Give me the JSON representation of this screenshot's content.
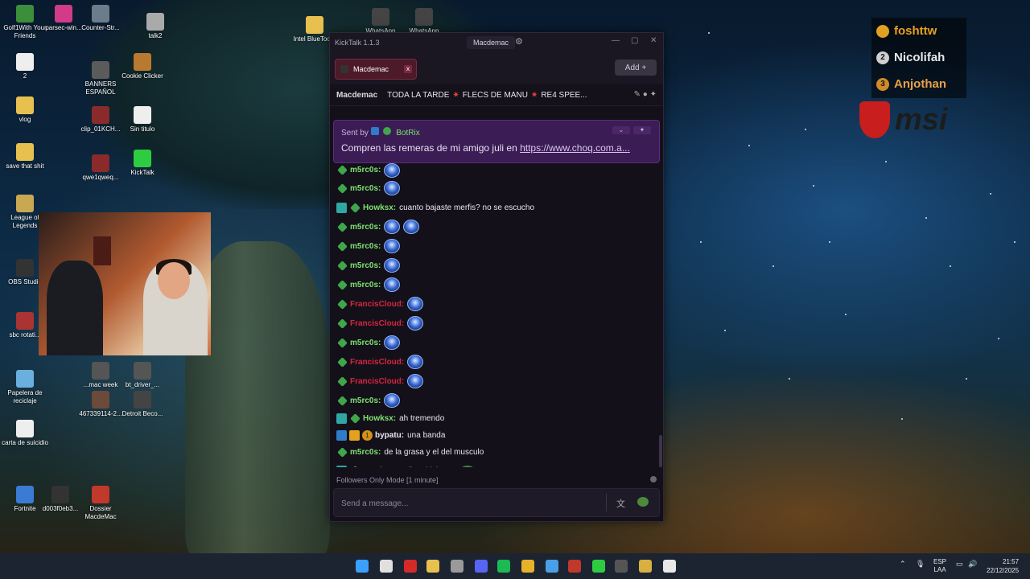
{
  "desktop": {
    "icons": [
      {
        "label": "Golf1With Your Friends",
        "color": "#3b8e3a"
      },
      {
        "label": "parsec-win...",
        "color": "#d13b8a"
      },
      {
        "label": "Counter-Str...",
        "color": "#6b7d8a"
      },
      {
        "label": "talk2",
        "color": "#aaaaaa"
      },
      {
        "label": "2",
        "color": "#eeeeee"
      },
      {
        "label": "BANNERS ESPAÑOL",
        "color": "#5b5b5b"
      },
      {
        "label": "Cookie Clicker",
        "color": "#b97a2f"
      },
      {
        "label": "vlog",
        "color": "#e8c050"
      },
      {
        "label": "clip_01KCH...",
        "color": "#8a2a2a"
      },
      {
        "label": "Sin titulo",
        "color": "#eeeeee"
      },
      {
        "label": "save that shit",
        "color": "#e8c050"
      },
      {
        "label": "qwe1qweq...",
        "color": "#8a2a2a"
      },
      {
        "label": "KickTalk",
        "color": "#2ecc40"
      },
      {
        "label": "League of Legends",
        "color": "#c8a850"
      },
      {
        "label": "OBS Studio",
        "color": "#333333"
      },
      {
        "label": "sbc rotati...",
        "color": "#a33"
      },
      {
        "label": "...mac week",
        "color": "#555"
      },
      {
        "label": "bt_driver_...",
        "color": "#555"
      },
      {
        "label": "Papelera de reciclaje",
        "color": "#6ab0de"
      },
      {
        "label": "467339114-2...",
        "color": "#6b4a3a"
      },
      {
        "label": "Detroit Beco...",
        "color": "#444"
      },
      {
        "label": "carta de suicidio",
        "color": "#eeeeee"
      },
      {
        "label": "Fortnite",
        "color": "#3a7bd5"
      },
      {
        "label": "d003f0eb3...",
        "color": "#333"
      },
      {
        "label": "Dossier MacdeMac",
        "color": "#c0392b"
      },
      {
        "label": "Intel BlueTooth",
        "color": "#e8c050"
      },
      {
        "label": "WhatsApp",
        "color": "#444"
      },
      {
        "label": "WhatsApp",
        "color": "#444"
      }
    ]
  },
  "leaderboard": [
    {
      "rank": "",
      "name": "foshttw",
      "badge_color": "#e0a020",
      "text_color": "#e8a01c"
    },
    {
      "rank": "2",
      "name": "Nicolifah",
      "badge_color": "#cfcfcf",
      "text_color": "#e8e8e8"
    },
    {
      "rank": "3",
      "name": "Anjothan",
      "badge_color": "#d08a2a",
      "text_color": "#e8a048"
    }
  ],
  "brand": {
    "logo_text": "msi"
  },
  "window": {
    "app_name": "KickTalk 1.1.3",
    "active_channel_chip": "Macdemac",
    "tab": {
      "label": "Macdemac",
      "close": "x"
    },
    "add_label": "Add +",
    "channel": {
      "name": "Macdemac",
      "title_parts": [
        "TODA LA TARDE",
        "FLECS DE MANU",
        "RE4 SPEE..."
      ]
    },
    "pinned": {
      "sent_by_label": "Sent by",
      "author": "BotRix",
      "text": "Compren las remeras de mi amigo juli en ",
      "link": "https://www.choq.com.a..."
    },
    "messages": [
      {
        "user": "m5rc0s:",
        "text": "",
        "color": "#7ee36f",
        "badges": [
          "sub"
        ],
        "emotes": 1,
        "compact": true
      },
      {
        "user": "m5rc0s:",
        "text": "",
        "color": "#7ee36f",
        "badges": [
          "sub"
        ],
        "emotes": 1
      },
      {
        "user": "Howksx:",
        "text": "cuanto bajaste merfis? no se escucho",
        "color": "#7ee36f",
        "badges": [
          "mod",
          "sub"
        ],
        "emotes": 0
      },
      {
        "user": "m5rc0s:",
        "text": "",
        "color": "#7ee36f",
        "badges": [
          "sub"
        ],
        "emotes": 2
      },
      {
        "user": "m5rc0s:",
        "text": "",
        "color": "#7ee36f",
        "badges": [
          "sub"
        ],
        "emotes": 1
      },
      {
        "user": "m5rc0s:",
        "text": "",
        "color": "#7ee36f",
        "badges": [
          "sub"
        ],
        "emotes": 1
      },
      {
        "user": "m5rc0s:",
        "text": "",
        "color": "#7ee36f",
        "badges": [
          "sub"
        ],
        "emotes": 1
      },
      {
        "user": "FrancisCloud:",
        "text": "",
        "color": "#d6263d",
        "badges": [
          "sub"
        ],
        "emotes": 1
      },
      {
        "user": "FrancisCloud:",
        "text": "",
        "color": "#d6263d",
        "badges": [
          "sub"
        ],
        "emotes": 1
      },
      {
        "user": "m5rc0s:",
        "text": "",
        "color": "#7ee36f",
        "badges": [
          "sub"
        ],
        "emotes": 1
      },
      {
        "user": "FrancisCloud:",
        "text": "",
        "color": "#d6263d",
        "badges": [
          "sub"
        ],
        "emotes": 1
      },
      {
        "user": "FrancisCloud:",
        "text": "",
        "color": "#d6263d",
        "badges": [
          "sub"
        ],
        "emotes": 1
      },
      {
        "user": "m5rc0s:",
        "text": "",
        "color": "#7ee36f",
        "badges": [
          "sub"
        ],
        "emotes": 1
      },
      {
        "user": "Howksx:",
        "text": "ah tremendo",
        "color": "#7ee36f",
        "badges": [
          "mod",
          "sub"
        ],
        "emotes": 0,
        "compact": true
      },
      {
        "user": "bypatu:",
        "text": "una banda",
        "color": "#e9e6ee",
        "badges": [
          "blue",
          "crown",
          "one"
        ],
        "emotes": 0,
        "compact": true
      },
      {
        "user": "m5rc0s:",
        "text": "de la grasa y el del musculo",
        "color": "#7ee36f",
        "badges": [
          "sub"
        ],
        "emotes": 0,
        "compact": true
      },
      {
        "user": "Howksx:",
        "text": "q dieta hicistes?",
        "color": "#7ee36f",
        "badges": [
          "mod",
          "sub"
        ],
        "emotes": 0,
        "frog": true
      }
    ],
    "followers_mode": "Followers Only Mode [1 minute]",
    "input_placeholder": "Send a message..."
  },
  "taskbar": {
    "language": "ESP",
    "language_sub": "LAA",
    "time": "21:57",
    "date": "22/12/2025",
    "apps": [
      {
        "name": "windows-start",
        "color": "#3aa0ff"
      },
      {
        "name": "search",
        "color": "#e0e0e0"
      },
      {
        "name": "app-red",
        "color": "#d62a2a"
      },
      {
        "name": "file-explorer",
        "color": "#e8c050"
      },
      {
        "name": "app-gray",
        "color": "#9a9a9a"
      },
      {
        "name": "discord",
        "color": "#5865f2"
      },
      {
        "name": "spotify",
        "color": "#1db954"
      },
      {
        "name": "chrome",
        "color": "#e8b12a"
      },
      {
        "name": "app-blue",
        "color": "#4aa0e8"
      },
      {
        "name": "app-red2",
        "color": "#c0392b"
      },
      {
        "name": "kick",
        "color": "#2ecc40"
      },
      {
        "name": "obs",
        "color": "#555555"
      },
      {
        "name": "app-yellow",
        "color": "#d8b040"
      },
      {
        "name": "app-white",
        "color": "#e8e8e8"
      }
    ]
  }
}
